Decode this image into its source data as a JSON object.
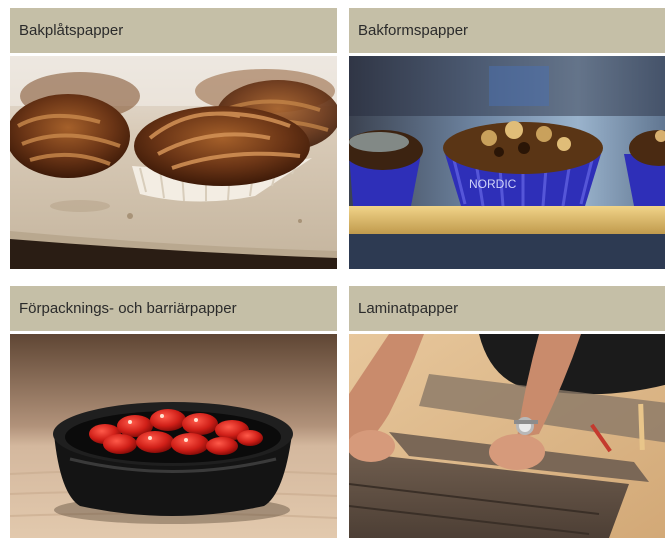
{
  "cards": [
    {
      "title": "Bakplåtspapper",
      "image": "pastries-on-baking-paper"
    },
    {
      "title": "Bakformspapper",
      "image": "muffins-in-blue-cups"
    },
    {
      "title": "Förpacknings- och barriärpapper",
      "image": "strawberries-in-black-bowl"
    },
    {
      "title": "Laminatpapper",
      "image": "laminate-floor-installation"
    }
  ],
  "colors": {
    "header_bg": "#c5bfa7",
    "cup_blue": "#2e2fb8"
  }
}
